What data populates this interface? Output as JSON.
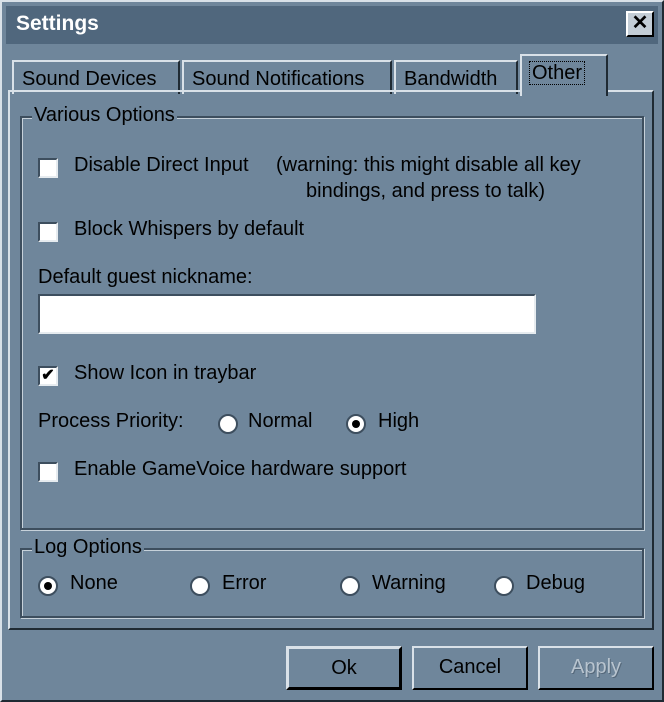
{
  "window": {
    "title": "Settings",
    "close_glyph": "✕"
  },
  "tabs": [
    {
      "label": "Sound Devices"
    },
    {
      "label": "Sound Notifications"
    },
    {
      "label": "Bandwidth"
    },
    {
      "label": "Other",
      "active": true
    }
  ],
  "various": {
    "legend": "Various Options",
    "disable_direct_input": {
      "label": "Disable Direct Input",
      "checked": false
    },
    "warning_line1": "(warning: this might disable all key",
    "warning_line2": "bindings, and press to talk)",
    "block_whispers": {
      "label": "Block Whispers by default",
      "checked": false
    },
    "guest_nick_label": "Default guest nickname:",
    "guest_nick_value": "",
    "show_icon": {
      "label": "Show Icon in traybar",
      "checked": true,
      "mark": "✔"
    },
    "priority_label": "Process Priority:",
    "priority_normal": "Normal",
    "priority_high": "High",
    "priority_selected": "High",
    "gamevoice": {
      "label": "Enable GameVoice hardware support",
      "checked": false
    }
  },
  "log": {
    "legend": "Log Options",
    "none": "None",
    "error": "Error",
    "warning": "Warning",
    "debug": "Debug",
    "selected": "None"
  },
  "buttons": {
    "ok": "Ok",
    "cancel": "Cancel",
    "apply": "Apply"
  }
}
